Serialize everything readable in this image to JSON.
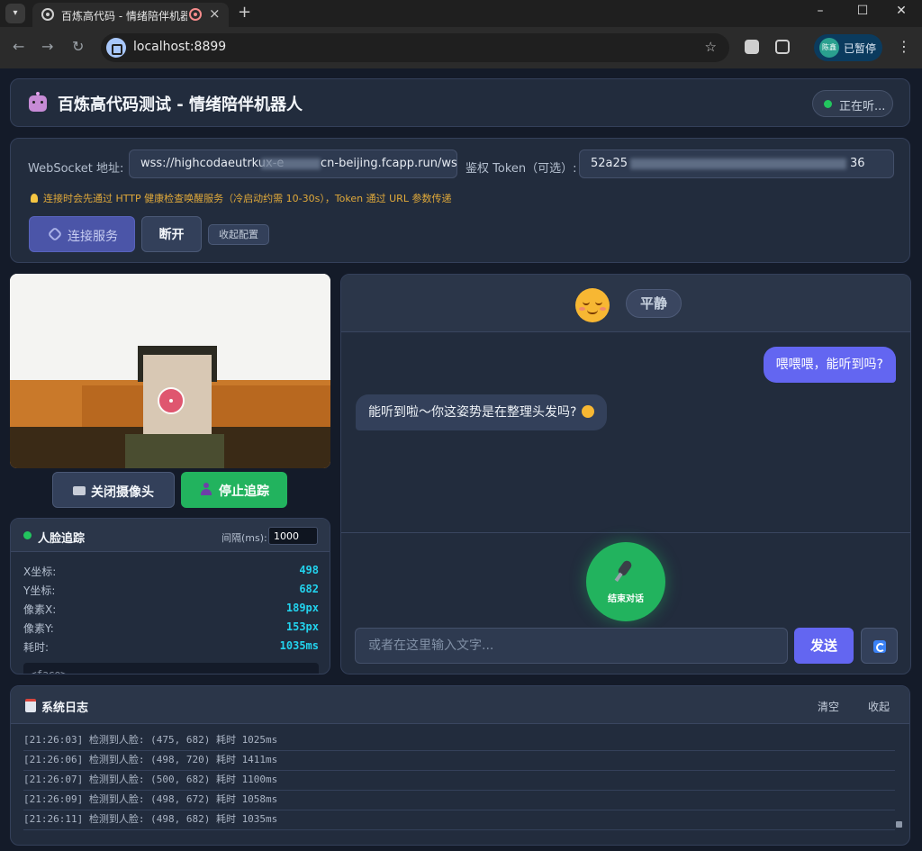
{
  "browser": {
    "tab_title": "百炼高代码 - 情绪陪伴机器人",
    "url": "localhost:8899",
    "profile_label": "已暂停",
    "profile_avatar_text": "陈鑫"
  },
  "header": {
    "title": "百炼高代码测试 - 情绪陪伴机器人",
    "status": "正在听..."
  },
  "config": {
    "ws_label": "WebSocket 地址:",
    "ws_value_visible_start": "wss://highcodaeutrkux-e",
    "ws_value_visible_end": "cn-beijing.fcapp.run/ws",
    "token_label": "鉴权 Token（可选）:",
    "token_value_visible_start": "52a25",
    "token_value_visible_end": "36",
    "hint": "连接时会先通过 HTTP 健康检查唤醒服务（冷启动约需 10-30s），Token 通过 URL 参数传递",
    "connect_button": "连接服务",
    "disconnect_button": "断开",
    "collapse_button": "收起配置"
  },
  "camera": {
    "close_button": "关闭摄像头",
    "stop_tracking_button": "停止追踪"
  },
  "tracking": {
    "title": "人脸追踪",
    "interval_label": "间隔(ms):",
    "interval_value": "1000",
    "stats": [
      {
        "label": "X坐标:",
        "value": "498"
      },
      {
        "label": "Y坐标:",
        "value": "682"
      },
      {
        "label": "像素X:",
        "value": "189px"
      },
      {
        "label": "像素Y:",
        "value": "153px"
      },
      {
        "label": "耗时:",
        "value": "1035ms"
      }
    ],
    "face_tag": "<face>"
  },
  "chat": {
    "mood": "平静",
    "messages": [
      {
        "role": "user",
        "text": "喂喂喂，能听到吗?"
      },
      {
        "role": "bot",
        "text": "能听到啦～你这姿势是在整理头发吗?"
      }
    ],
    "mic_label": "结束对话",
    "input_placeholder": "或者在这里输入文字...",
    "send_button": "发送"
  },
  "log": {
    "title": "系统日志",
    "clear_button": "清空",
    "collapse_button": "收起",
    "lines": [
      "[21:26:03] 检测到人脸: (475, 682) 耗时 1025ms",
      "[21:26:06] 检测到人脸: (498, 720) 耗时 1411ms",
      "[21:26:07] 检测到人脸: (500, 682) 耗时 1100ms",
      "[21:26:09] 检测到人脸: (498, 672) 耗时 1058ms",
      "[21:26:11] 检测到人脸: (498, 682) 耗时 1035ms"
    ]
  }
}
